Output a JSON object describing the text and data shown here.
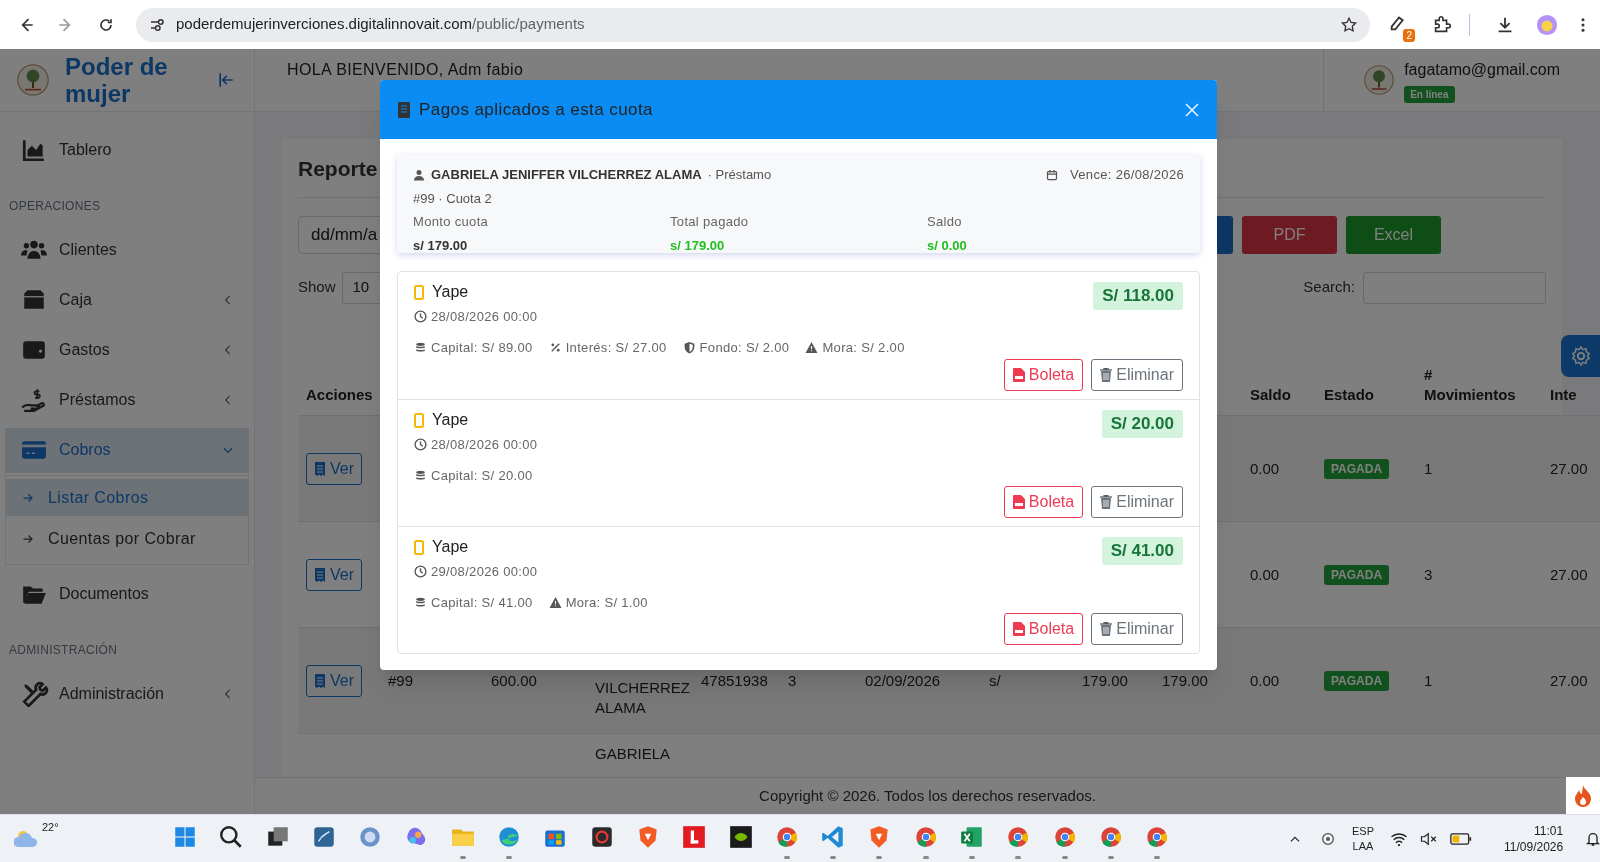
{
  "browser": {
    "url_host": "poderdemujerinverciones.digitalinnovait.com",
    "url_path": "/public/payments",
    "extension_badge": "2"
  },
  "sidebar": {
    "brand": "Poder de mujer",
    "items": [
      {
        "kind": "link",
        "label": "Tablero",
        "selected": false
      },
      {
        "kind": "heading",
        "label": "OPERACIONES"
      },
      {
        "kind": "link",
        "label": "Clientes",
        "selected": false
      },
      {
        "kind": "link",
        "label": "Caja",
        "selected": false,
        "expanded": false
      },
      {
        "kind": "link",
        "label": "Gastos",
        "selected": false,
        "expanded": false
      },
      {
        "kind": "link",
        "label": "Préstamos",
        "selected": false,
        "expanded": false
      },
      {
        "kind": "link",
        "label": "Cobros",
        "selected": true,
        "expanded": true,
        "children": [
          {
            "label": "Listar Cobros",
            "selected": true
          },
          {
            "label": "Cuentas por Cobrar",
            "selected": false
          }
        ]
      },
      {
        "kind": "link",
        "label": "Documentos",
        "selected": false
      },
      {
        "kind": "heading",
        "label": "ADMINISTRACIÓN"
      },
      {
        "kind": "link",
        "label": "Administración",
        "selected": false,
        "expanded": false
      }
    ]
  },
  "header": {
    "greeting": "HOLA BIENVENIDO, Adm fabio",
    "email": "fagatamo@gmail.com",
    "status": "En línea"
  },
  "report": {
    "title": "Reporte",
    "date_field": "dd/mm/a",
    "buttons": [
      {
        "kind": "primary"
      },
      {
        "kind": "pdf",
        "label": "PDF"
      },
      {
        "kind": "excel",
        "label": "Excel"
      }
    ],
    "show_label": "Show",
    "page_size": "10",
    "search_label": "Search:"
  },
  "table": {
    "columns": [
      "Acciones",
      null,
      null,
      null,
      null,
      null,
      null,
      null,
      null,
      null,
      "Saldo",
      "Estado",
      "# Movimientos",
      "Inte"
    ],
    "rows": [
      [
        "Ver",
        null,
        null,
        null,
        null,
        null,
        null,
        null,
        null,
        null,
        "0.00",
        "PAGADA",
        "1",
        "27.00"
      ],
      [
        "Ver",
        null,
        null,
        null,
        null,
        null,
        null,
        null,
        null,
        null,
        "0.00",
        "PAGADA",
        "3",
        "27.00"
      ],
      [
        "Ver",
        "#99",
        "600.00",
        "VILCHERREZ ALAMA",
        "47851938",
        "3",
        "02/09/2026",
        "s/",
        "179.00",
        "179.00",
        "0.00",
        "PAGADA",
        "1",
        "27.00"
      ],
      [
        null,
        null,
        null,
        "GABRIELA",
        null,
        null,
        null,
        null,
        null,
        null,
        null,
        null,
        null,
        null
      ]
    ]
  },
  "footer": "Copyright © 2026. Todos los derechos reservados.",
  "modal": {
    "title": "Pagos aplicados a esta cuota",
    "summary": {
      "client": "GABRIELA JENIFFER VILCHERREZ ALAMA",
      "type": "· Préstamo",
      "due": "Vence: 26/08/2026",
      "ref": "#99 · Cuota 2",
      "stats": [
        {
          "label": "Monto cuota",
          "value": "s/ 179.00",
          "kind": "neutral"
        },
        {
          "label": "Total pagado",
          "value": "s/ 179.00",
          "kind": "paid"
        },
        {
          "label": "Saldo",
          "value": "s/ 0.00",
          "kind": "paid"
        }
      ]
    },
    "payments": [
      {
        "method": "Yape",
        "datetime": "28/08/2026 00:00",
        "amount": "S/ 118.00",
        "details": [
          {
            "kind": "capital",
            "text": "Capital: S/ 89.00"
          },
          {
            "kind": "interest",
            "text": "Interés: S/ 27.00"
          },
          {
            "kind": "fund",
            "text": "Fondo: S/ 2.00"
          },
          {
            "kind": "late",
            "text": "Mora: S/ 2.00"
          }
        ],
        "actions": [
          "Boleta",
          "Eliminar"
        ]
      },
      {
        "method": "Yape",
        "datetime": "28/08/2026 00:00",
        "amount": "S/ 20.00",
        "details": [
          {
            "kind": "capital",
            "text": "Capital: S/ 20.00"
          }
        ],
        "actions": [
          "Boleta",
          "Eliminar"
        ]
      },
      {
        "method": "Yape",
        "datetime": "29/08/2026 00:00",
        "amount": "S/ 41.00",
        "details": [
          {
            "kind": "capital",
            "text": "Capital: S/ 41.00"
          },
          {
            "kind": "late",
            "text": "Mora: S/ 1.00"
          }
        ],
        "actions": [
          "Boleta",
          "Eliminar"
        ]
      }
    ]
  },
  "taskbar": {
    "weather": "22°",
    "language": [
      "ESP",
      "LAA"
    ],
    "time": "11:01",
    "date": "11/09/2026"
  }
}
